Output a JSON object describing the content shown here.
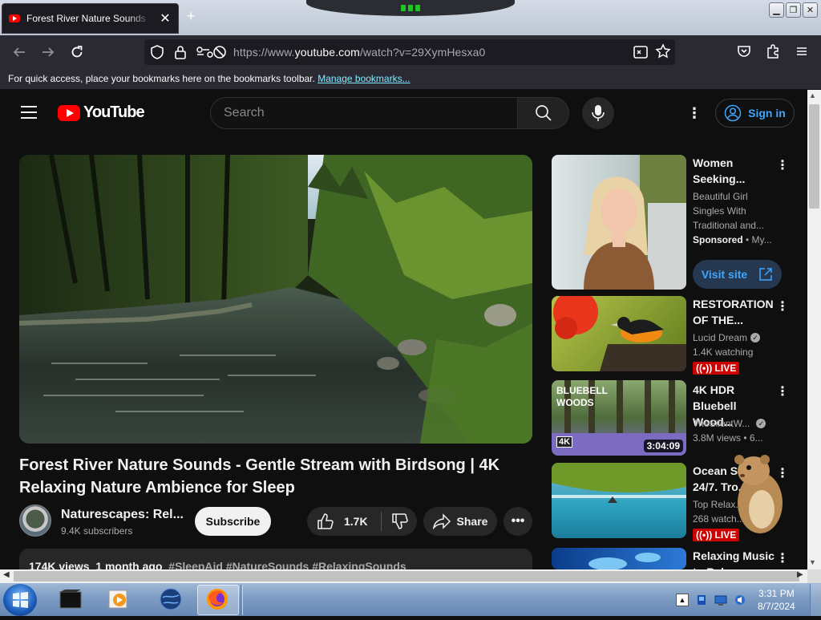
{
  "browser": {
    "tab_title": "Forest River Nature Sounds - Gentle Stream with Birdsong | 4K",
    "tab_close": "✕",
    "new_tab": "+",
    "url_prefix": "https://www.",
    "url_host": "youtube.com",
    "url_path": "/watch?v=29XymHesxa0",
    "bookmarks_msg": "For quick access, place your bookmarks here on the bookmarks toolbar.",
    "bookmarks_link": "Manage bookmarks..."
  },
  "youtube": {
    "logo_text": "YouTube",
    "search_placeholder": "Search",
    "sign_in": "Sign in"
  },
  "video": {
    "title": "Forest River Nature Sounds - Gentle Stream with Birdsong | 4K Relaxing Nature Ambience for Sleep",
    "channel": "Naturescapes: Rel...",
    "subscribers": "9.4K subscribers",
    "subscribe": "Subscribe",
    "likes": "1.7K",
    "share": "Share",
    "views": "174K views",
    "age": "1 month ago",
    "tags": "#SleepAid #NatureSounds #RelaxingSounds"
  },
  "sidebar": [
    {
      "title": "Women Seeking...",
      "line1": "Beautiful Girl",
      "line2": "Singles With",
      "line3": "Traditional and...",
      "sponsored": "Sponsored",
      "sponsor_name": " • My...",
      "cta": "Visit site"
    },
    {
      "title": "RESTORATION OF THE...",
      "channel": "Lucid Dream",
      "meta": "1.4K watching",
      "badge": "LIVE"
    },
    {
      "title": "4K HDR Bluebell Wood...",
      "channel": "TheSilentW...",
      "meta": "3.8M views  • 6...",
      "duration": "3:04:09",
      "thumb_text1": "BLUEBELL",
      "thumb_text2": "WOODS",
      "thumb_badge": "4K"
    },
    {
      "title": "Ocean So... 24/7. Tro...",
      "channel": "Top Relax...",
      "meta": "268 watch...",
      "badge": "LIVE"
    },
    {
      "title": "Relaxing Music to Relax..."
    }
  ],
  "taskbar": {
    "time": "3:31 PM",
    "date": "8/7/2024"
  },
  "colors": {
    "yt_red": "#ff0000",
    "link_blue": "#3ea6ff",
    "live_red": "#cc0000",
    "page_bg": "#0f0f0f"
  }
}
